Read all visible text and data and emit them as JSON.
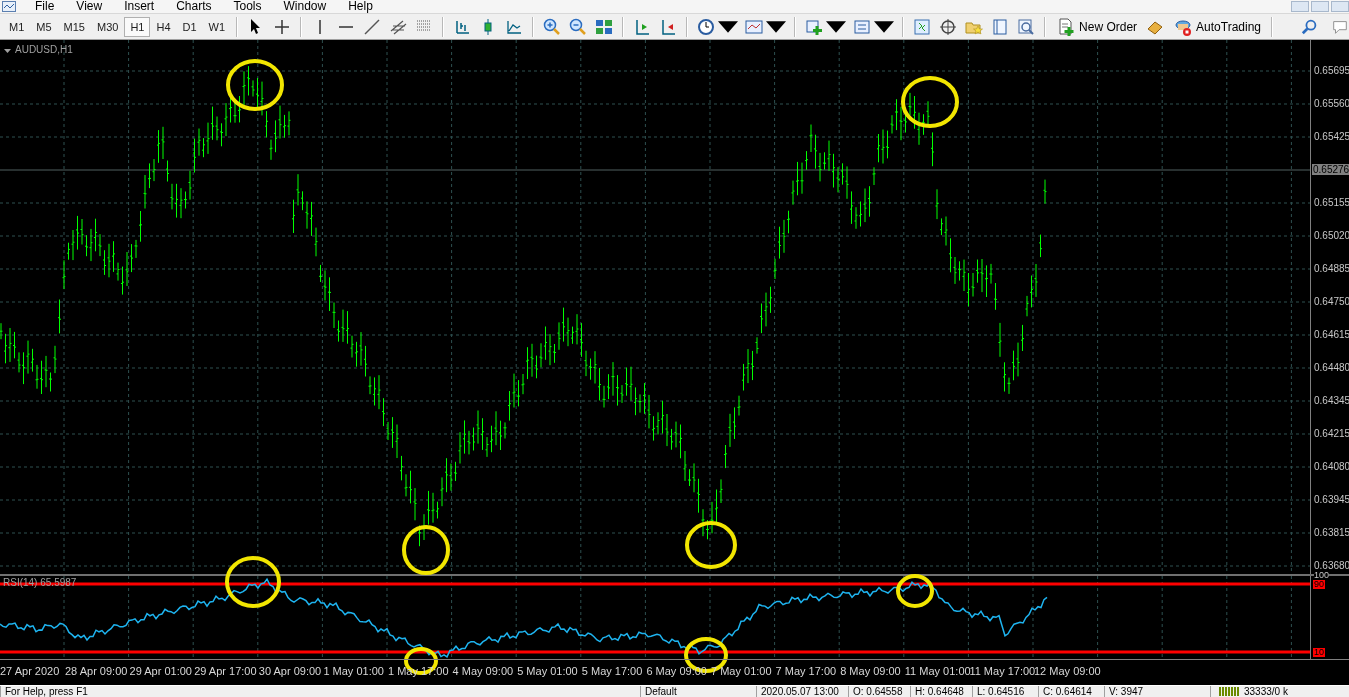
{
  "menu": [
    "File",
    "View",
    "Insert",
    "Charts",
    "Tools",
    "Window",
    "Help"
  ],
  "timeframes": [
    {
      "label": "M1",
      "selected": false
    },
    {
      "label": "M5",
      "selected": false
    },
    {
      "label": "M15",
      "selected": false
    },
    {
      "label": "M30",
      "selected": false
    },
    {
      "label": "H1",
      "selected": true
    },
    {
      "label": "H4",
      "selected": false
    },
    {
      "label": "D1",
      "selected": false
    },
    {
      "label": "W1",
      "selected": false
    }
  ],
  "toolbar_buttons": [
    "New Order",
    "AutoTrading"
  ],
  "chart": {
    "symbol_label": "AUDUSD,H1",
    "price_axis": [
      {
        "text": "0.65695",
        "kind": "tick"
      },
      {
        "text": "0.65560",
        "kind": "tick"
      },
      {
        "text": "0.65425",
        "kind": "tick"
      },
      {
        "text": "0.65276",
        "kind": "current"
      },
      {
        "text": "0.65155",
        "kind": "tick"
      },
      {
        "text": "0.65020",
        "kind": "tick"
      },
      {
        "text": "0.64885",
        "kind": "tick"
      },
      {
        "text": "0.64750",
        "kind": "tick"
      },
      {
        "text": "0.64615",
        "kind": "tick"
      },
      {
        "text": "0.64480",
        "kind": "tick"
      },
      {
        "text": "0.64345",
        "kind": "tick"
      },
      {
        "text": "0.64215",
        "kind": "tick"
      },
      {
        "text": "0.64080",
        "kind": "tick"
      },
      {
        "text": "0.63945",
        "kind": "tick"
      },
      {
        "text": "0.63815",
        "kind": "tick"
      },
      {
        "text": "0.63680",
        "kind": "tick"
      }
    ],
    "indicator": {
      "label": "RSI(14) 65.5987",
      "scale_max": "100",
      "levels": [
        "90",
        "10"
      ]
    },
    "time_axis": [
      "27 Apr 2020",
      "28 Apr 09:00",
      "29 Apr 01:00",
      "29 Apr 17:00",
      "30 Apr 09:00",
      "1 May 01:00",
      "1 May 17:00",
      "4 May 09:00",
      "5 May 01:00",
      "5 May 17:00",
      "6 May 09:00",
      "7 May 01:00",
      "7 May 17:00",
      "8 May 09:00",
      "11 May 01:00",
      "11 May 17:00",
      "12 May 09:00"
    ]
  },
  "status_bar": [
    "For Help, press F1",
    "Default",
    "2020.05.07 13:00",
    "O: 0.64558",
    "H: 0.64648",
    "L: 0.64516",
    "C: 0.64614",
    "V: 3947",
    "33333/0 k"
  ]
}
